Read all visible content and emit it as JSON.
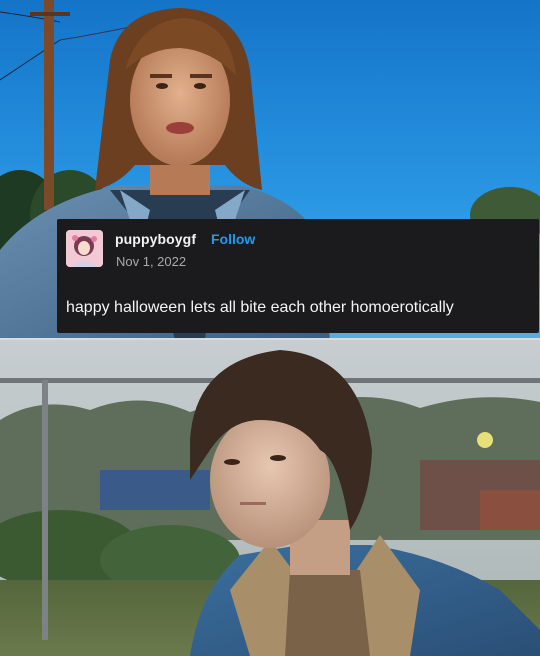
{
  "post": {
    "username": "puppyboygf",
    "follow_label": "Follow",
    "date": "Nov 1, 2022",
    "text": "happy halloween lets all bite each other homoerotically"
  },
  "colors": {
    "card_bg": "#1b1b1d",
    "follow_blue": "#1d9bf0",
    "sky_blue": "#1a86d8"
  },
  "icons": {
    "avatar": "avatar-image"
  }
}
